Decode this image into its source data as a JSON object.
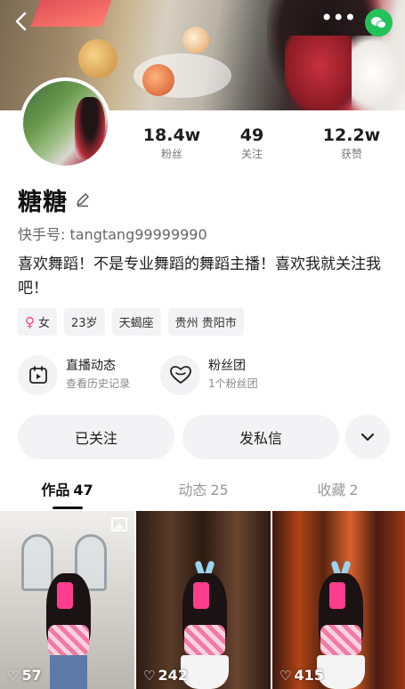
{
  "header": {
    "back_icon": "chevron-left-icon",
    "more_icon": "more-dots-icon",
    "more_glyph": "•••",
    "share_icon": "wechat-icon"
  },
  "profile": {
    "name": "糖糖",
    "kuaishou_id": "快手号: tangtang99999990",
    "bio": "喜欢舞蹈！不是专业舞蹈的舞蹈主播！喜欢我就关注我吧！",
    "stats": [
      {
        "value": "18.4w",
        "label": "粉丝"
      },
      {
        "value": "49",
        "label": "关注"
      },
      {
        "value": "12.2w",
        "label": "获赞"
      }
    ],
    "tags": {
      "gender_symbol": "♀",
      "gender": "女",
      "age": "23岁",
      "zodiac": "天蝎座",
      "location": "贵州 贵阳市"
    }
  },
  "features": [
    {
      "title": "直播动态",
      "subtitle": "查看历史记录",
      "icon": "calendar-play-icon"
    },
    {
      "title": "粉丝团",
      "subtitle": "1个粉丝团",
      "icon": "heart-badge-icon"
    }
  ],
  "actions": {
    "follow_label": "已关注",
    "message_label": "发私信",
    "more_icon": "chevron-down-icon"
  },
  "tabs": [
    {
      "label": "作品",
      "count": "47",
      "active": true
    },
    {
      "label": "动态",
      "count": "25",
      "active": false
    },
    {
      "label": "收藏",
      "count": "2",
      "active": false
    }
  ],
  "works": [
    {
      "likes": "57",
      "heart": "♡"
    },
    {
      "likes": "242",
      "heart": "♡"
    },
    {
      "likes": "415",
      "heart": "♡"
    }
  ],
  "colors": {
    "accent_pink": "#ff3f7a",
    "wechat_green": "#24c35a",
    "chip_bg": "#f3f3f5"
  }
}
